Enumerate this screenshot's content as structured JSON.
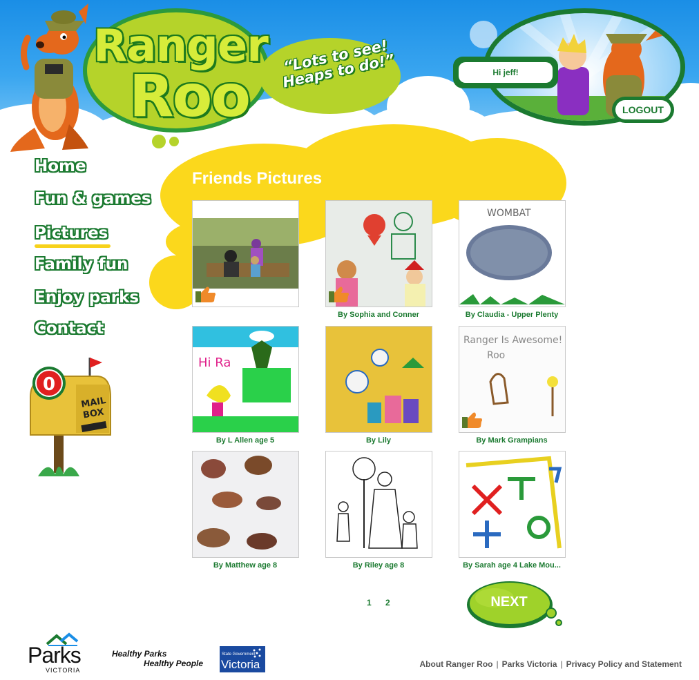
{
  "header": {
    "logo_line1": "Ranger",
    "logo_line2": "Roo",
    "tagline": "“Lots to see! Heaps to do!”",
    "greeting": "Hi jeff!",
    "logout_label": "LOGOUT"
  },
  "nav": {
    "items": [
      {
        "label": "Home"
      },
      {
        "label": "Fun & games"
      },
      {
        "label": "Pictures",
        "active": true
      },
      {
        "label": "Family fun"
      },
      {
        "label": "Enjoy parks"
      },
      {
        "label": "Contact"
      }
    ]
  },
  "mailbox": {
    "count": "0",
    "label_line1": "MAIL",
    "label_line2": "BOX"
  },
  "content": {
    "title": "Friends Pictures",
    "pictures": [
      {
        "caption": "",
        "liked": true
      },
      {
        "caption": "By Sophia and Conner",
        "liked": true
      },
      {
        "caption": "By Claudia - Upper Plenty",
        "liked": false
      },
      {
        "caption": "By L Allen age 5",
        "liked": false
      },
      {
        "caption": "By Lily",
        "liked": false
      },
      {
        "caption": "By Mark Grampians",
        "liked": true
      },
      {
        "caption": "By Matthew age 8",
        "liked": false
      },
      {
        "caption": "By Riley age 8",
        "liked": false
      },
      {
        "caption": "By Sarah age 4 Lake Mou...",
        "liked": false
      }
    ],
    "pagination": {
      "pages": [
        "1",
        "2"
      ],
      "next_label": "NEXT"
    }
  },
  "footer": {
    "parks_logo_line1": "Parks",
    "parks_logo_line2": "VICTORIA",
    "healthy_line1": "Healthy Parks",
    "healthy_line2": "Healthy People",
    "gov_line1": "State Government",
    "gov_line2": "Victoria",
    "links": [
      "About Ranger Roo",
      "Parks Victoria",
      "Privacy Policy and Statement"
    ]
  },
  "colors": {
    "sky": "#1a8ee6",
    "brand_green": "#1b7a30",
    "lime": "#b5d32a",
    "yellow": "#fbd81c"
  }
}
